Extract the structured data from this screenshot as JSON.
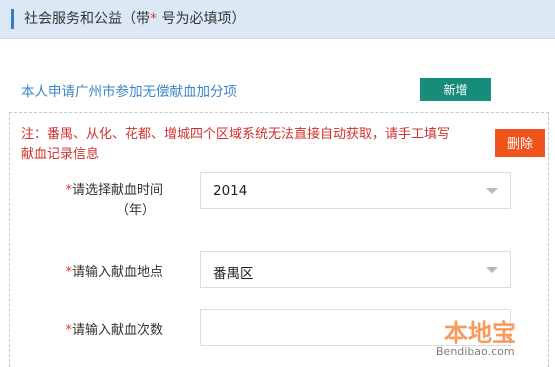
{
  "header": {
    "title_prefix": "社会服务和公益（带",
    "required_mark": "*",
    "title_suffix": " 号为必填项）"
  },
  "apply": {
    "label": "本人申请广州市参加无偿献血加分项",
    "add_label": "新增"
  },
  "record": {
    "notice": "注：番禺、从化、花都、增城四个区域系统无法直接自动获取，请手工填写献血记录信息",
    "delete_label": "删除",
    "year_label_line1": "请选择献血时间",
    "year_label_line2": "（年）",
    "year_value": "2014",
    "place_label": "请输入献血地点",
    "place_value": "番禺区",
    "count_label": "请输入献血次数",
    "count_value": ""
  },
  "watermark": {
    "text": "本地宝",
    "url": "Bendibao.com"
  },
  "colors": {
    "header_bg": "#dce9f5",
    "accent_blue": "#2f7fc9",
    "add_button": "#168c7b",
    "delete_button": "#f0541d",
    "notice_red": "#d0312d"
  }
}
